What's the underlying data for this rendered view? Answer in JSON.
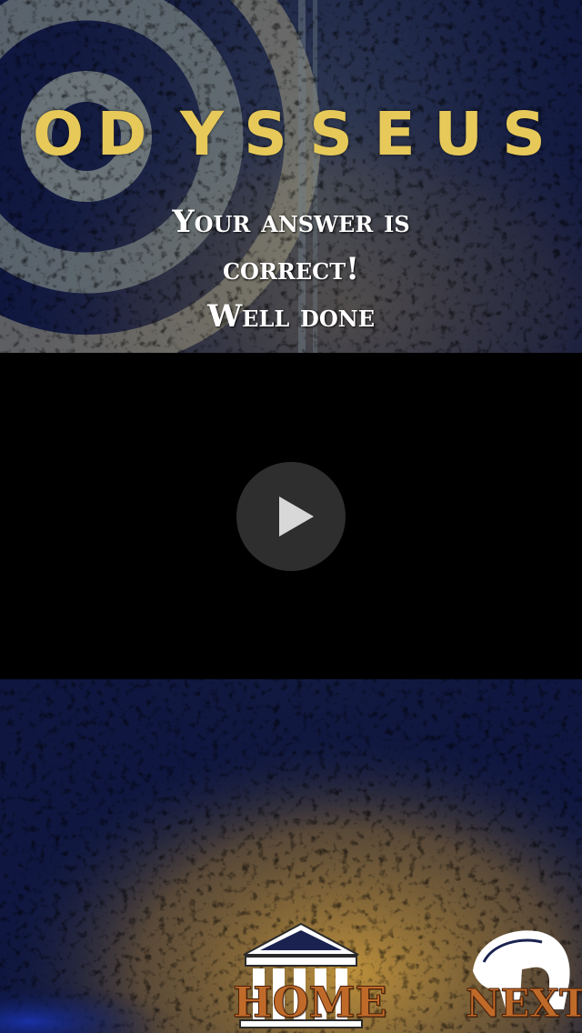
{
  "app": {
    "title": "ODYSSEUS",
    "title_letters": [
      "O",
      "D",
      "Y",
      "S",
      "S",
      "E",
      "U",
      "S"
    ]
  },
  "result": {
    "line1": "Your answer is",
    "line2": "correct!",
    "line3": "Well done"
  },
  "video": {
    "play_icon": "play-icon"
  },
  "nav": {
    "home_label": "HOME",
    "home_icon": "temple-icon",
    "next_label": "NEXT",
    "next_icon": "spartan-helmet-icon"
  },
  "colors": {
    "title": "#e7c95a",
    "nav_label": "#c06a2a",
    "background_navy": "#0b1230",
    "background_gold": "#b08a3a"
  }
}
